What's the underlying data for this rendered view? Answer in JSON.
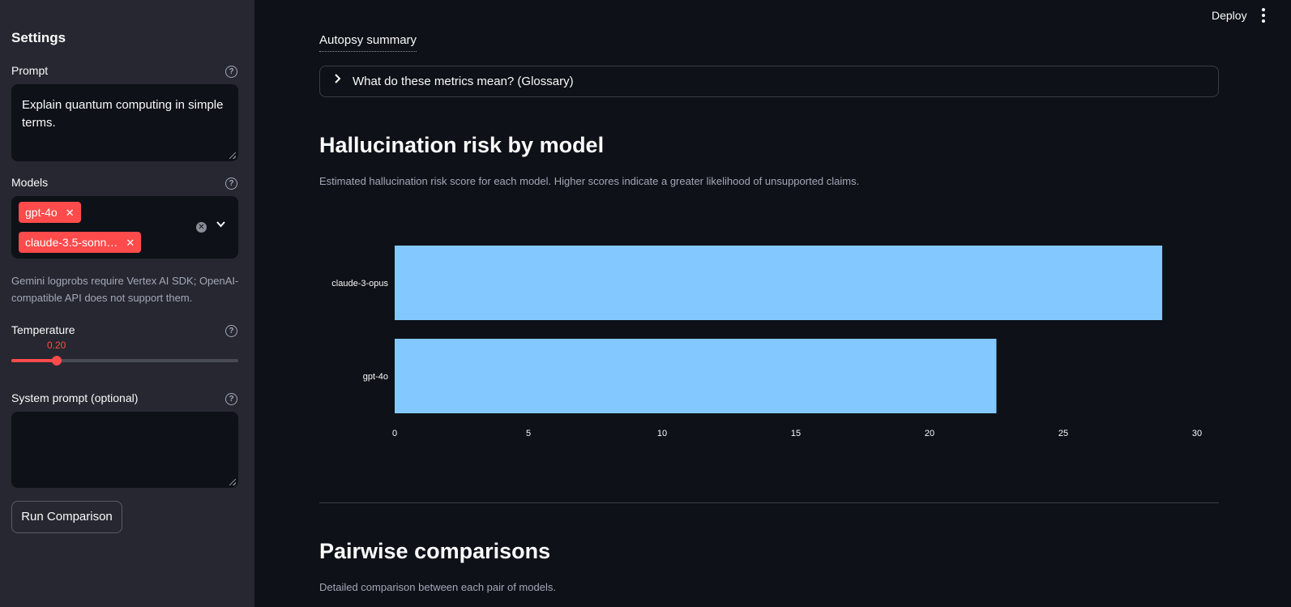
{
  "sidebar": {
    "title": "Settings",
    "prompt_label": "Prompt",
    "prompt_value": "Explain quantum computing in simple terms.",
    "models_label": "Models",
    "selected_models": [
      "gpt-4o",
      "claude-3.5-sonn…"
    ],
    "models_caption": "Gemini logprobs require Vertex AI SDK; OpenAI-compatible API does not support them.",
    "temperature_label": "Temperature",
    "temperature_value": "0.20",
    "temperature_fraction": 0.2,
    "system_prompt_label": "System prompt (optional)",
    "system_prompt_value": "",
    "run_button": "Run Comparison"
  },
  "header": {
    "deploy_label": "Deploy"
  },
  "main": {
    "autopsy_title": "Autopsy summary",
    "glossary_label": "What do these metrics mean? (Glossary)",
    "section1_title": "Hallucination risk by model",
    "section1_caption": "Estimated hallucination risk score for each model. Higher scores indicate a greater likelihood of unsupported claims.",
    "section2_title": "Pairwise comparisons",
    "section2_caption": "Detailed comparison between each pair of models."
  },
  "chart_data": {
    "type": "bar",
    "orientation": "horizontal",
    "categories": [
      "claude-3-opus",
      "gpt-4o"
    ],
    "values": [
      28.7,
      22.5
    ],
    "xlim": [
      0,
      30
    ],
    "xticks": [
      0,
      5,
      10,
      15,
      20,
      25,
      30
    ],
    "bar_color": "#83c9ff",
    "grid": false,
    "title": "",
    "xlabel": "",
    "ylabel": ""
  }
}
